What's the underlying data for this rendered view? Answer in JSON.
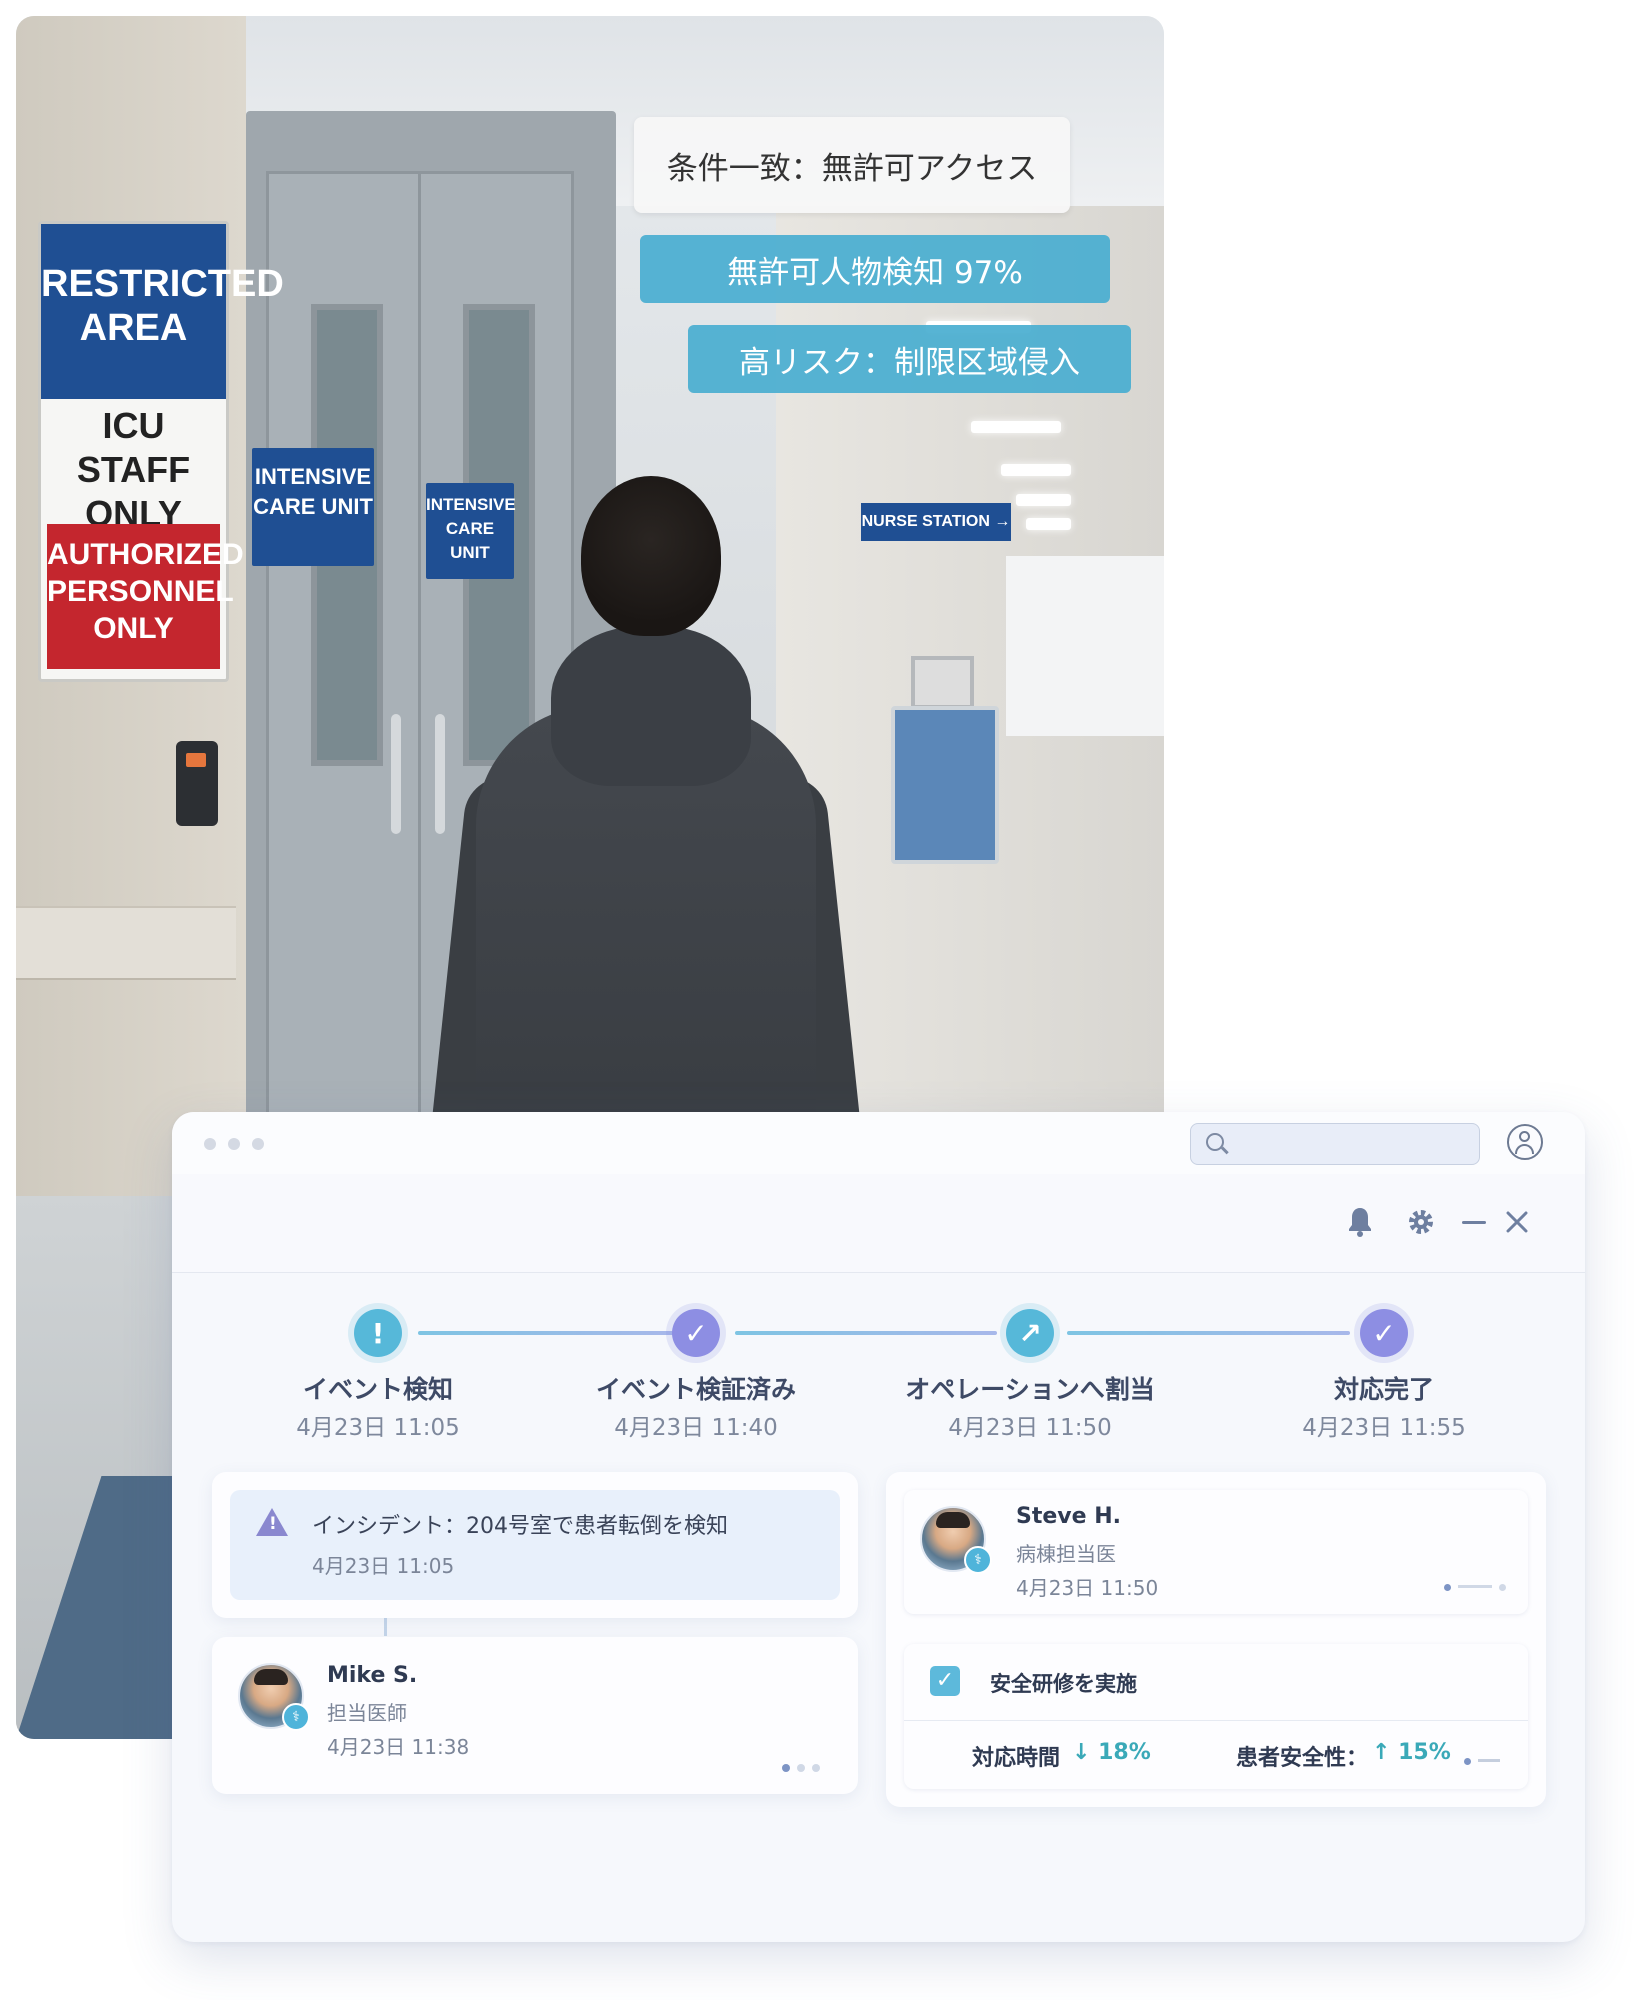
{
  "overlay": {
    "condition": "条件一致：無許可アクセス",
    "detection": "無許可人物検知 97%",
    "risk": "高リスク：制限区域侵入"
  },
  "scene": {
    "sign_main": "RESTRICTED AREA",
    "sign_sub": "ICU STAFF ONLY",
    "sign_warning": "AUTHORIZED PERSONNEL ONLY",
    "door_sign": "INTENSIVE CARE UNIT",
    "nurse_sign": "NURSE STATION →"
  },
  "window": {
    "search": {
      "placeholder": "",
      "value": ""
    },
    "icons": [
      "bell-icon",
      "gear-icon",
      "minimize-icon",
      "close-icon",
      "user-avatar-icon",
      "search-icon"
    ]
  },
  "steps": [
    {
      "label": "イベント検知",
      "date": "4月23日 11:05",
      "icon": "!",
      "color": "teal"
    },
    {
      "label": "イベント検証済み",
      "date": "4月23日 11:40",
      "icon": "✓",
      "color": "purple"
    },
    {
      "label": "オペレーションへ割当",
      "date": "4月23日 11:50",
      "icon": "↗",
      "color": "teal"
    },
    {
      "label": "対応完了",
      "date": "4月23日 11:55",
      "icon": "✓",
      "color": "purple"
    }
  ],
  "incident": {
    "title": "インシデント：204号室で患者転倒を検知",
    "date": "4月23日 11:05"
  },
  "person_mike": {
    "name": "Mike S.",
    "role": "担当医師",
    "date": "4月23日 11:38"
  },
  "person_steve": {
    "name": "Steve H.",
    "role": "病棟担当医",
    "date": "4月23日 11:50"
  },
  "task": {
    "label": "安全研修を実施",
    "checked": true
  },
  "metrics": {
    "response_label": "対応時間",
    "response_value": "↓ 18%",
    "safety_label": "患者安全性：",
    "safety_value": "↑ 15%"
  },
  "colors": {
    "teal": "#56b8d9",
    "purple": "#8d8ee3",
    "metric_green": "#3aa9b8"
  }
}
